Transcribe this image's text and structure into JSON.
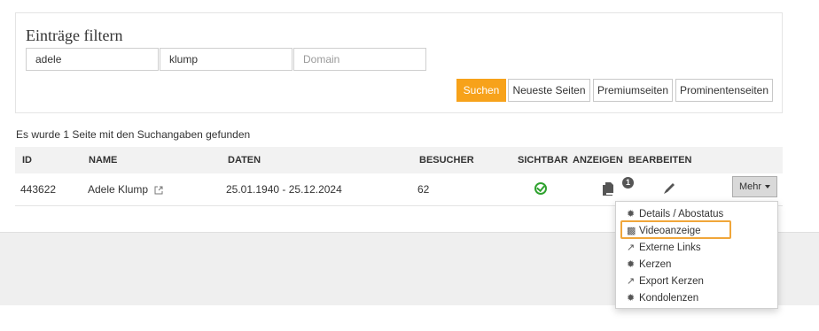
{
  "filter": {
    "title": "Einträge filtern",
    "first_name_value": "adele",
    "last_name_value": "klump",
    "domain_placeholder": "Domain",
    "search_label": "Suchen",
    "newest_pages_label": "Neueste Seiten",
    "premium_pages_label": "Premiumseiten",
    "prominent_pages_label": "Prominentenseiten"
  },
  "result_message": "Es wurde 1 Seite mit den Suchangaben gefunden",
  "table": {
    "headers": {
      "id": "ID",
      "name": "NAME",
      "dates": "DATEN",
      "visitors": "BESUCHER",
      "visible": "SICHTBAR",
      "ads": "ANZEIGEN",
      "edit": "BEARBEITEN"
    },
    "rows": [
      {
        "id": "443622",
        "name": "Adele Klump",
        "dates": "25.01.1940 - 25.12.2024",
        "visitors": "62",
        "ads_count": "1",
        "more_label": "Mehr"
      }
    ]
  },
  "dropdown": {
    "items": [
      {
        "label": "Details / Abostatus",
        "icon": "gear-icon"
      },
      {
        "label": "Videoanzeige",
        "icon": "film-icon"
      },
      {
        "label": "Externe Links",
        "icon": "external-link-icon"
      },
      {
        "label": "Kerzen",
        "icon": "gear-icon"
      },
      {
        "label": "Export Kerzen",
        "icon": "external-link-icon"
      },
      {
        "label": "Kondolenzen",
        "icon": "gear-icon"
      }
    ]
  },
  "colors": {
    "accent": "#f7a21a",
    "highlight": "#f0a63a",
    "visible_check": "#2fa22f"
  }
}
